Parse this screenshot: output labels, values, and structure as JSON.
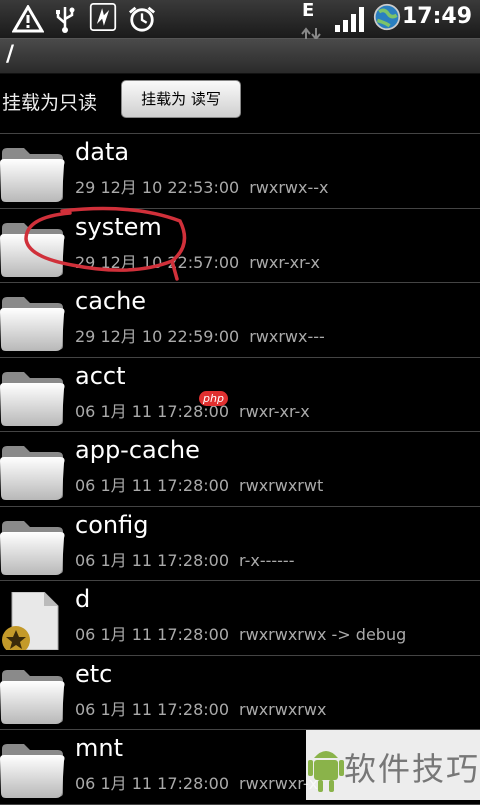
{
  "status_bar": {
    "time": "17:49",
    "network_type": "E",
    "icons": [
      "warning-icon",
      "usb-icon",
      "debug-icon",
      "alarm-icon",
      "data-transfer-icon",
      "signal-icon",
      "globe-icon"
    ]
  },
  "path": "/",
  "mount": {
    "status_label": "挂载为只读",
    "button_label": "挂载为 读写"
  },
  "files": [
    {
      "name": "data",
      "date": "29 12月 10 22:53:00",
      "perms": "rwxrwx--x",
      "type": "folder"
    },
    {
      "name": "system",
      "date": "29 12月 10 22:57:00",
      "perms": "rwxr-xr-x",
      "type": "folder"
    },
    {
      "name": "cache",
      "date": "29 12月 10 22:59:00",
      "perms": "rwxrwx---",
      "type": "folder"
    },
    {
      "name": "acct",
      "date": "06 1月 11 17:28:00",
      "perms": "rwxr-xr-x",
      "type": "folder"
    },
    {
      "name": "app-cache",
      "date": "06 1月 11 17:28:00",
      "perms": "rwxrwxrwt",
      "type": "folder"
    },
    {
      "name": "config",
      "date": "06 1月 11 17:28:00",
      "perms": "r-x------",
      "type": "folder"
    },
    {
      "name": "d",
      "date": "06 1月 11 17:28:00",
      "perms": "rwxrwxrwx  -> debug",
      "type": "link"
    },
    {
      "name": "etc",
      "date": "06 1月 11 17:28:00",
      "perms": "rwxrwxrwx",
      "type": "folder"
    },
    {
      "name": "mnt",
      "date": "06 1月 11 17:28:00",
      "perms": "rwxrwxr-x",
      "type": "folder"
    }
  ],
  "watermark": {
    "badge": "php",
    "text": "软件技巧"
  }
}
